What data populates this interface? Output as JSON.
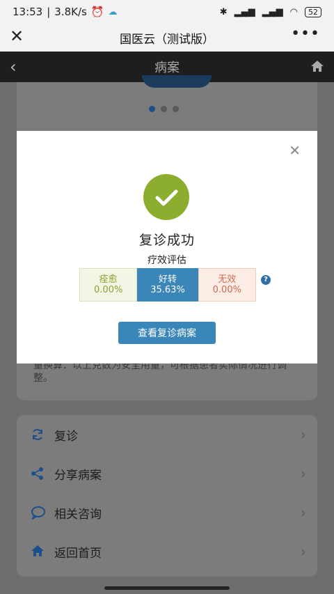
{
  "status": {
    "time": "13:53",
    "speed": "3.8K/s",
    "battery": "52"
  },
  "wechat": {
    "title": "国医云（测试版）"
  },
  "header": {
    "title": "病案"
  },
  "background": {
    "note": "量换算：以上克数为安全用量，可根据患者实际情况进行调整。",
    "menu": [
      {
        "label": "复诊",
        "icon": "refresh-icon"
      },
      {
        "label": "分享病案",
        "icon": "share-icon"
      },
      {
        "label": "相关咨询",
        "icon": "chat-icon"
      },
      {
        "label": "返回首页",
        "icon": "home-icon"
      }
    ]
  },
  "modal": {
    "title": "复诊成功",
    "subtitle": "疗效评估",
    "evaluation": [
      {
        "label": "痊愈",
        "value": "0.00%"
      },
      {
        "label": "好转",
        "value": "35.63%"
      },
      {
        "label": "无效",
        "value": "0.00%"
      }
    ],
    "help": "?",
    "button": "查看复诊病案"
  },
  "colors": {
    "accent": "#3a86b8",
    "success": "#8cad2e",
    "header_bg": "#1e1e1e"
  }
}
